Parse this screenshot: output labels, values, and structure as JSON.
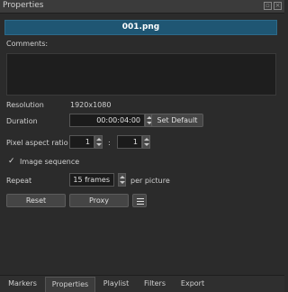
{
  "window": {
    "title": "Properties"
  },
  "clip": {
    "name": "001.png"
  },
  "comments": {
    "label": "Comments:",
    "value": ""
  },
  "resolution": {
    "label": "Resolution",
    "value": "1920x1080"
  },
  "duration": {
    "label": "Duration",
    "value": "00:00:04:00",
    "set_default_label": "Set Default"
  },
  "pixel_aspect": {
    "label": "Pixel aspect ratio",
    "num": "1",
    "separator": ":",
    "den": "1"
  },
  "image_sequence": {
    "label": "Image sequence",
    "checked": true,
    "check_glyph": "✓"
  },
  "repeat": {
    "label": "Repeat",
    "value": "15 frames",
    "suffix": "per picture"
  },
  "buttons": {
    "reset": "Reset",
    "proxy": "Proxy"
  },
  "tabs": [
    {
      "label": "Markers",
      "active": false
    },
    {
      "label": "Properties",
      "active": true
    },
    {
      "label": "Playlist",
      "active": false
    },
    {
      "label": "Filters",
      "active": false
    },
    {
      "label": "Export",
      "active": false
    }
  ],
  "icons": {
    "float": "float-icon",
    "close": "close-icon",
    "menu": "hamburger-menu-icon"
  }
}
